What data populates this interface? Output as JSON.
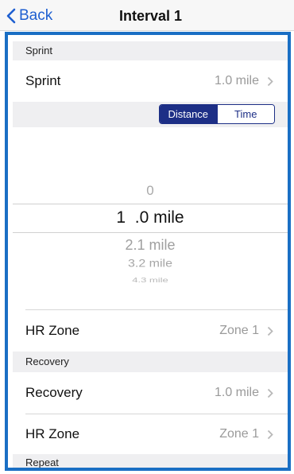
{
  "nav": {
    "back_label": "Back",
    "title": "Interval 1"
  },
  "sections": {
    "sprint_header": "Sprint",
    "recovery_header": "Recovery",
    "repeat_header": "Repeat"
  },
  "sprint": {
    "distance_label": "Sprint",
    "distance_value": "1.0 mile",
    "hr_label": "HR Zone",
    "hr_value": "Zone 1"
  },
  "segmented": {
    "options": [
      "Distance",
      "Time"
    ],
    "selected": "Distance"
  },
  "picker": {
    "above": "0",
    "selected": "1  .0 mile",
    "below": [
      "2.1 mile",
      "3.2 mile",
      "4.3 mile"
    ]
  },
  "recovery": {
    "distance_label": "Recovery",
    "distance_value": "1.0 mile",
    "hr_label": "HR Zone",
    "hr_value": "Zone 1"
  },
  "colors": {
    "accent": "#1d2f86",
    "link": "#1e5fd0",
    "frame": "#1a6fc4",
    "section_bg": "#efeff1",
    "secondary_text": "#9a9a9a"
  },
  "icons": {
    "back": "chevron-left-icon",
    "disclosure": "chevron-right-icon"
  }
}
